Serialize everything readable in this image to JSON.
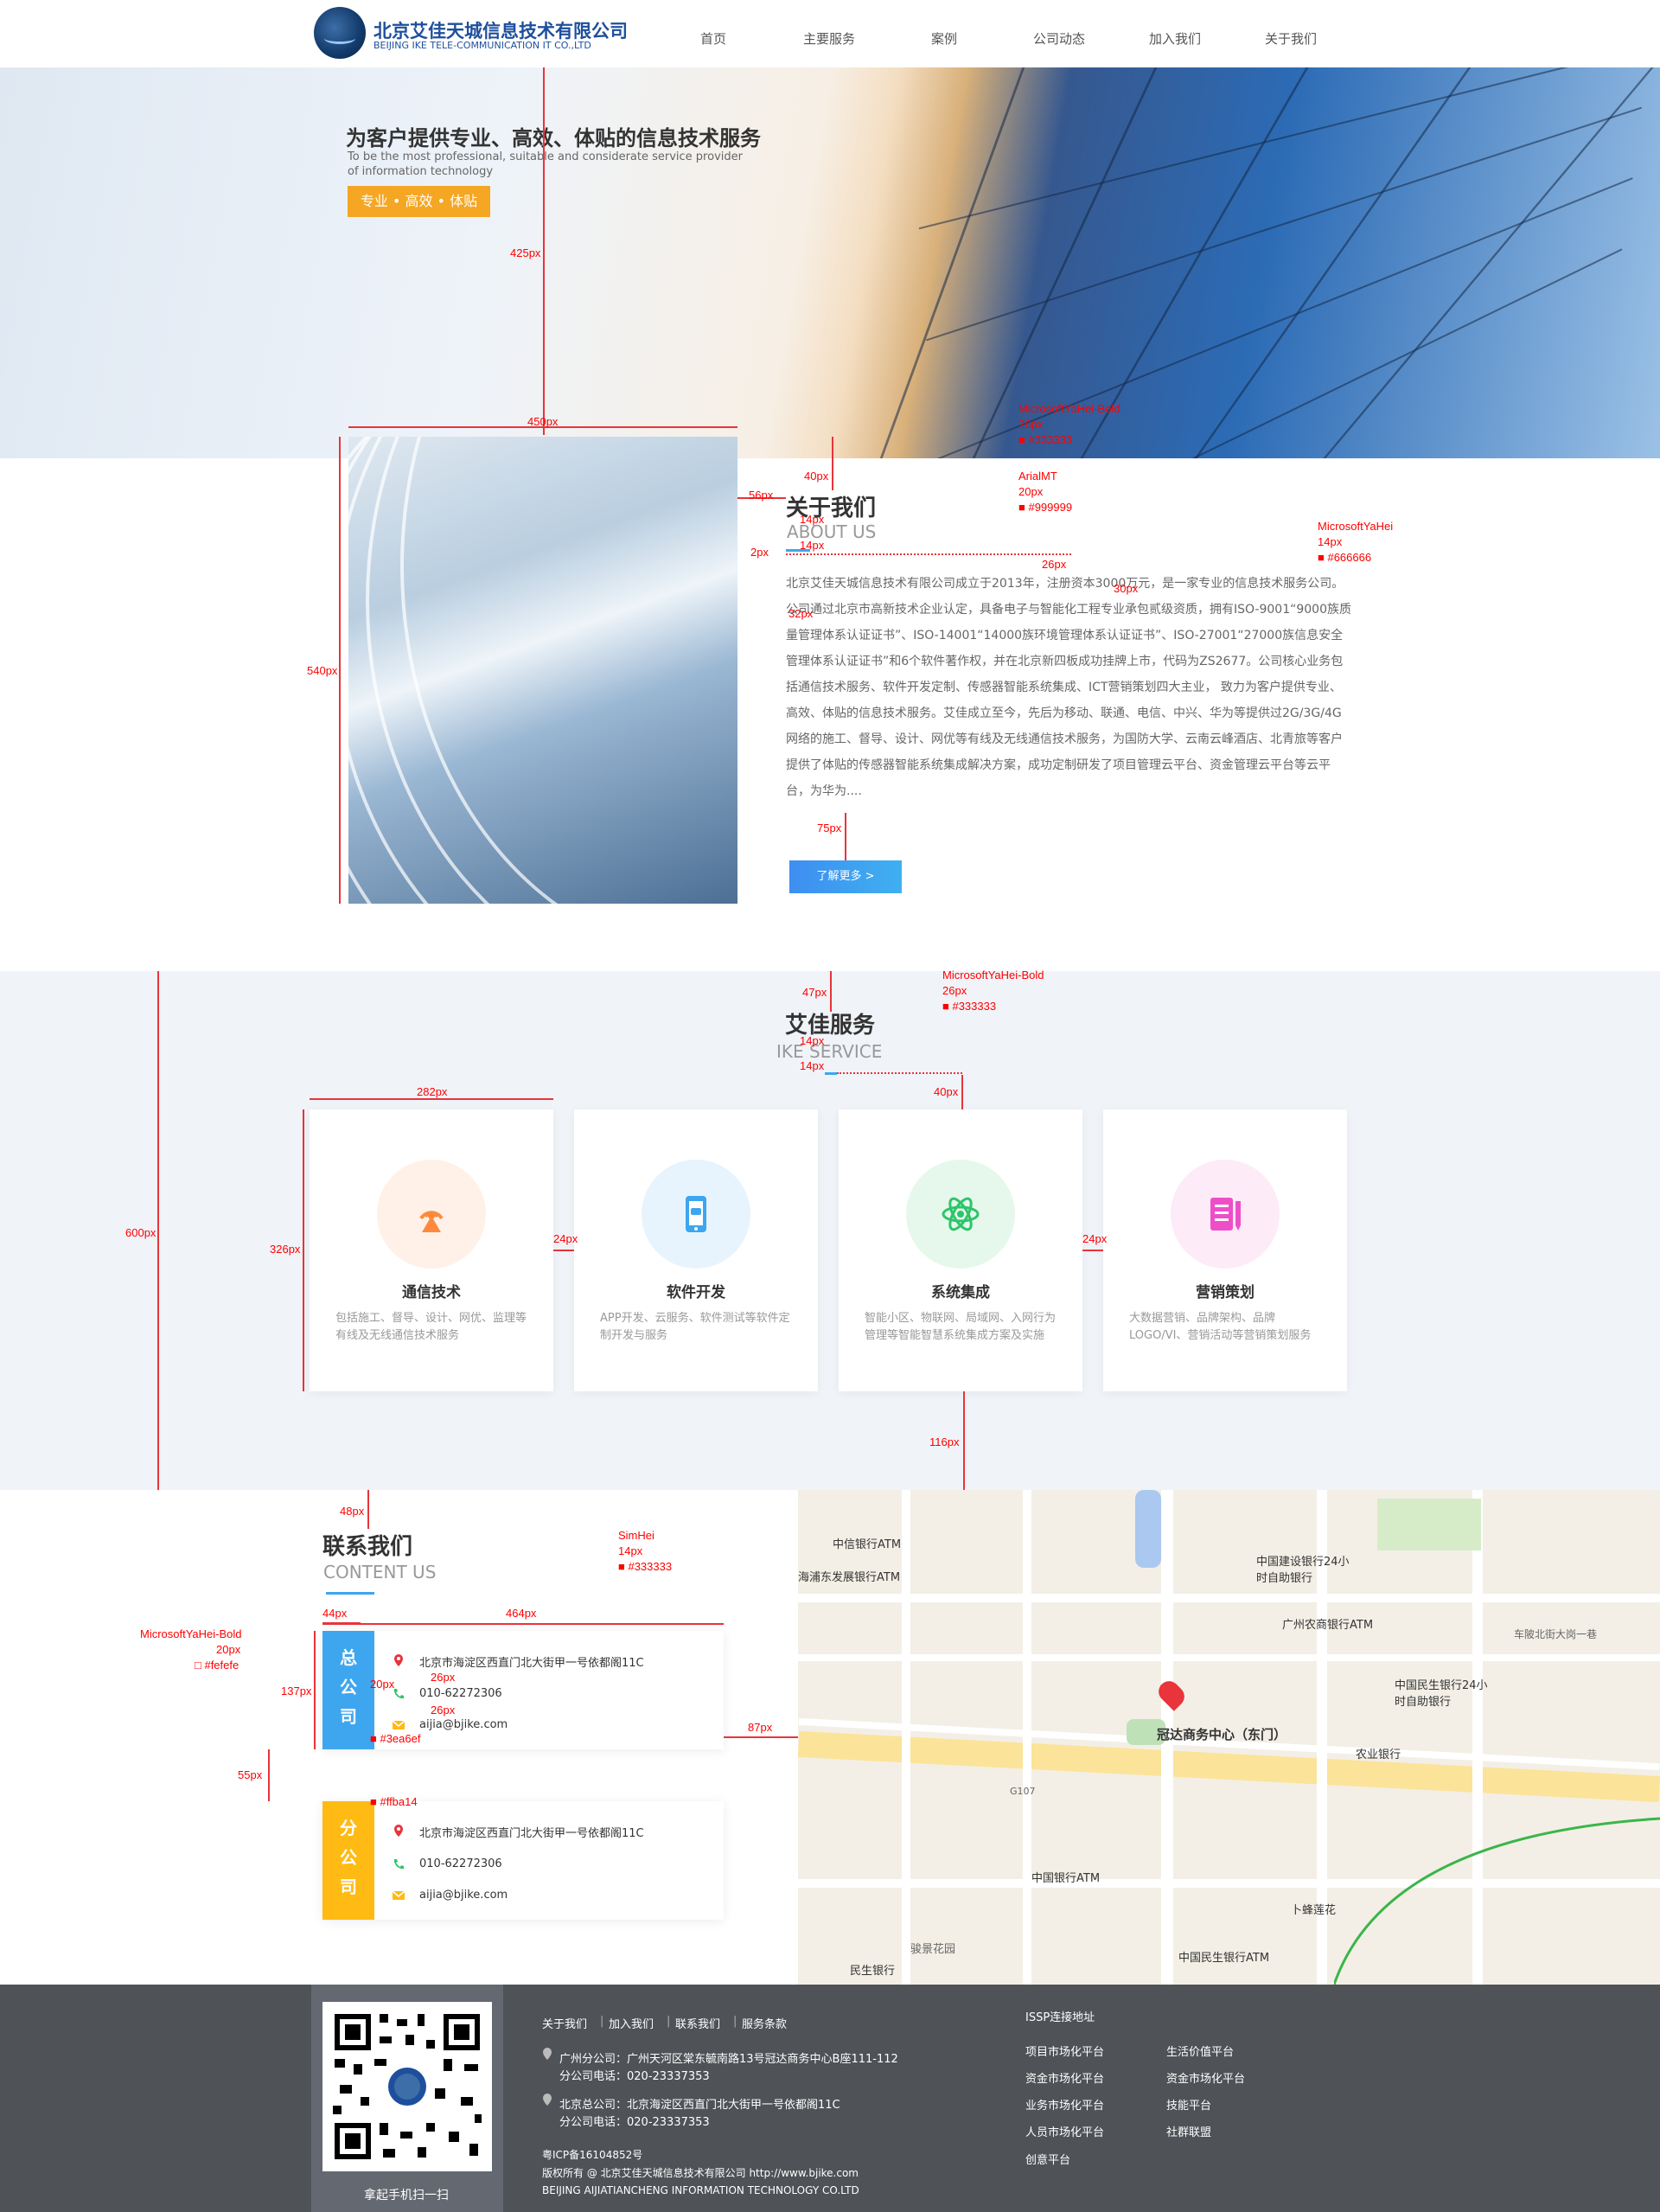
{
  "header": {
    "logo_cn": "北京艾佳天城信息技术有限公司",
    "logo_en": "BEIJING IKE TELE-COMMUNICATION IT CO.,LTD",
    "nav": [
      "首页",
      "主要服务",
      "案例",
      "公司动态",
      "加入我们",
      "关于我们"
    ]
  },
  "hero": {
    "title": "为客户提供专业、高效、体贴的信息技术服务",
    "subtitle": "To be the most professional, suitable and considerate service provider of information technology",
    "button": "专业 • 高效 • 体贴"
  },
  "about": {
    "title": "关于我们",
    "subtitle": "ABOUT US",
    "text": "北京艾佳天城信息技术有限公司成立于2013年，注册资本3000万元，是一家专业的信息技术服务公司。公司通过北京市高新技术企业认定，具备电子与智能化工程专业承包贰级资质，拥有ISO-9001“9000族质量管理体系认证证书”、ISO-14001“14000族环境管理体系认证证书”、ISO-27001“27000族信息安全管理体系认证证书”和6个软件著作权，并在北京新四板成功挂牌上市，代码为ZS2677。公司核心业务包括通信技术服务、软件开发定制、传感器智能系统集成、ICT营销策划四大主业， 致力为客户提供专业、高效、体贴的信息技术服务。艾佳成立至今，先后为移动、联通、电信、中兴、华为等提供过2G/3G/4G网络的施工、督导、设计、网优等有线及无线通信技术服务，为国防大学、云南云峰酒店、北青旅等客户提供了体贴的传感器智能系统集成解决方案，成功定制研发了项目管理云平台、资金管理云平台等云平台，为华为....",
    "button": "了解更多 >"
  },
  "services": {
    "title": "艾佳服务",
    "subtitle": "IKE SERVICE",
    "cards": [
      {
        "title": "通信技术",
        "desc": "包括施工、督导、设计、网优、监理等有线及无线通信技术服务",
        "color": "#ff8a3d",
        "bg": "#fff1e8",
        "icon": "signal-tower-icon"
      },
      {
        "title": "软件开发",
        "desc": "APP开发、云服务、软件测试等软件定制开发与服务",
        "color": "#3ea6ef",
        "bg": "#e8f4fd",
        "icon": "smartphone-icon"
      },
      {
        "title": "系统集成",
        "desc": "智能小区、物联网、局域网、入网行为管理等智能智慧系统集成方案及实施",
        "color": "#2ec46a",
        "bg": "#e6f8ec",
        "icon": "atom-icon"
      },
      {
        "title": "营销策划",
        "desc": "大数据营销、品牌架构、品牌LOGO/VI、营销活动等营销策划服务",
        "color": "#ee4fc9",
        "bg": "#fdebf8",
        "icon": "document-pen-icon"
      }
    ]
  },
  "contact": {
    "title": "联系我们",
    "subtitle": "CONTENT US",
    "branches": [
      {
        "tag": "总公司",
        "color": "#3ea6ef",
        "address": "北京市海淀区西直门北大街甲一号依都阁11C",
        "phone": "010-62272306",
        "email": "aijia@bjike.com"
      },
      {
        "tag": "分公司",
        "color": "#ffba14",
        "address": "北京市海淀区西直门北大街甲一号依都阁11C",
        "phone": "010-62272306",
        "email": "aijia@bjike.com"
      }
    ]
  },
  "map": {
    "marker_label": "冠达商务中心（东门）",
    "labels": [
      {
        "text": "中信银行ATM",
        "color": "#3a64c8"
      },
      {
        "text": "海浦东发展银行ATM",
        "color": "#3a64c8"
      },
      {
        "text": "中国建设银行24小时自助银行",
        "color": "#3a64c8"
      },
      {
        "text": "广州农商银行ATM",
        "color": "#3a64c8"
      },
      {
        "text": "中国民生银行24小时自助银行",
        "color": "#3a64c8"
      },
      {
        "text": "农业银行",
        "color": "#3a64c8"
      },
      {
        "text": "中国银行ATM",
        "color": "#3a64c8"
      },
      {
        "text": "卜蜂莲花",
        "color": "#3a64c8"
      },
      {
        "text": "中国民生银行ATM",
        "color": "#3a64c8"
      },
      {
        "text": "民生银行",
        "color": "#3a64c8"
      },
      {
        "text": "骏景花园",
        "color": "#666666"
      },
      {
        "text": "车陂北街大岗一巷",
        "color": "#666666"
      },
      {
        "text": "G107",
        "color": "#666666"
      }
    ]
  },
  "footer": {
    "qr_caption": "拿起手机扫一扫",
    "links": [
      "关于我们",
      "加入我们",
      "联系我们",
      "服务条款"
    ],
    "addr1": "广州分公司：广州天河区棠东毓南路13号冠达商务中心B座111-112",
    "phone1": "分公司电话：020-23337353",
    "addr2": "北京总公司：北京海淀区西直门北大街甲一号依都阁11C",
    "phone2": "分公司电话：020-23337353",
    "icp": "粤ICP备16104852号",
    "copyright": "版权所有 @ 北京艾佳天城信息技术有限公司 http://www.bjike.com",
    "company_en": "BEIJING AIJIATIANCHENG INFORMATION TECHNOLOGY CO.LTD",
    "issp_title": "ISSP连接地址",
    "issp_links": [
      "项目市场化平台",
      "生活价值平台",
      "资金市场化平台",
      "资金市场化平台",
      "业务市场化平台",
      "技能平台",
      "人员市场化平台",
      "社群联盟",
      "创意平台"
    ]
  },
  "annotations": {
    "h425": "425px",
    "w450": "450px",
    "h540": "540px",
    "f1_font": "MicrosoftYaHei-Bold",
    "f1_size": "26px",
    "f1_color": "■ #333333",
    "d40": "40px",
    "f2_font": "ArialMT",
    "f2_size": "20px",
    "f2_color": "■ #999999",
    "d56": "56px",
    "d14a": "14px",
    "f3_font": "MicrosoftYaHei",
    "f3_size": "14px",
    "f3_color": "■ #666666",
    "d2": "2px",
    "d14b": "14px",
    "d26": "26px",
    "d30": "30px",
    "d32": "32px",
    "d75": "75px",
    "d47": "47px",
    "f4_font": "MicrosoftYaHei-Bold",
    "f4_size": "26px",
    "f4_color": "■ #333333",
    "d14c": "14px",
    "d14d": "14px",
    "d40b": "40px",
    "d282": "282px",
    "h600": "600px",
    "h326": "326px",
    "d24a": "24px",
    "d24b": "24px",
    "d116": "116px",
    "d48": "48px",
    "f5_font": "SimHei",
    "f5_size": "14px",
    "f5_color": "■ #333333",
    "d44": "44px",
    "d464": "464px",
    "f6_font": "MicrosoftYaHei-Bold",
    "f6_size": "20px",
    "f6_color": "□ #fefefe",
    "d137": "137px",
    "d20": "20px",
    "d26b": "26px",
    "d26c": "26px",
    "c3ea6ef": "■ #3ea6ef",
    "d87": "87px",
    "d55": "55px",
    "cffba14": "■ #ffba14"
  }
}
